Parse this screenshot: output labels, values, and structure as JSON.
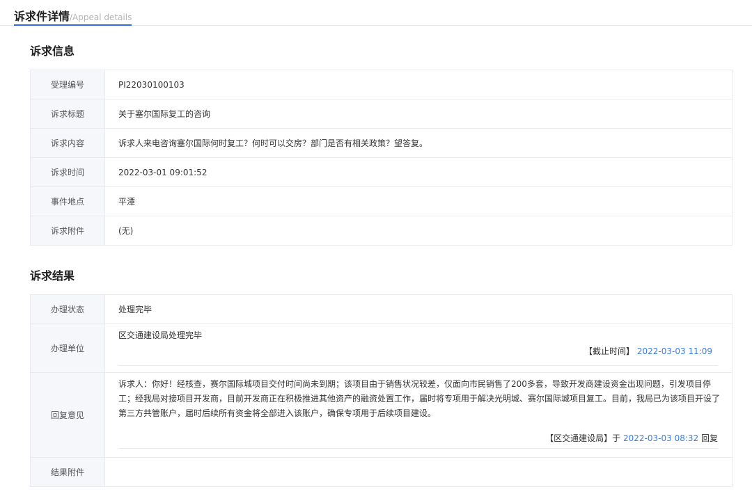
{
  "header": {
    "title_zh": "诉求件详情",
    "title_en": "/Appeal details"
  },
  "appeal_info": {
    "section_title": "诉求信息",
    "rows": [
      {
        "label": "受理编号",
        "value": "PI22030100103"
      },
      {
        "label": "诉求标题",
        "value": "关于塞尔国际复工的咨询"
      },
      {
        "label": "诉求内容",
        "value": "诉求人来电咨询塞尔国际何时复工？何时可以交房？部门是否有相关政策？望答复。"
      },
      {
        "label": "诉求时间",
        "value": "2022-03-01 09:01:52"
      },
      {
        "label": "事件地点",
        "value": "平潭"
      },
      {
        "label": "诉求附件",
        "value": "(无)"
      }
    ]
  },
  "appeal_result": {
    "section_title": "诉求结果",
    "status_label": "办理状态",
    "status_value": "处理完毕",
    "unit_label": "办理单位",
    "unit_text": "区交通建设局处理完毕",
    "deadline_label": "【截止时间】",
    "deadline_value": "2022-03-03 11:09",
    "reply_label": "回复意见",
    "reply_text": "诉求人：你好！经核查，赛尔国际城项目交付时间尚未到期；该项目由于销售状况较差，仅面向市民销售了200多套，导致开发商建设资金出现问题，引发项目停工；经我局对接项目开发商，目前开发商正在积极推进其他资产的融资处置工作，届时将专项用于解决光明城、赛尔国际城项目复工。目前，我局已为该项目开设了第三方共管账户，届时后续所有资金将全部进入该账户，确保专项用于后续项目建设。",
    "reply_org": "【区交通建设局】于",
    "reply_time": "2022-03-03 08:32",
    "reply_suffix": "回复",
    "attachment_label": "结果附件",
    "attachment_value": ""
  },
  "colors": {
    "accent": "#2f6fd6",
    "link": "#3a7ee0",
    "label_bg": "#f5f7fa",
    "border": "#e8eaed"
  }
}
